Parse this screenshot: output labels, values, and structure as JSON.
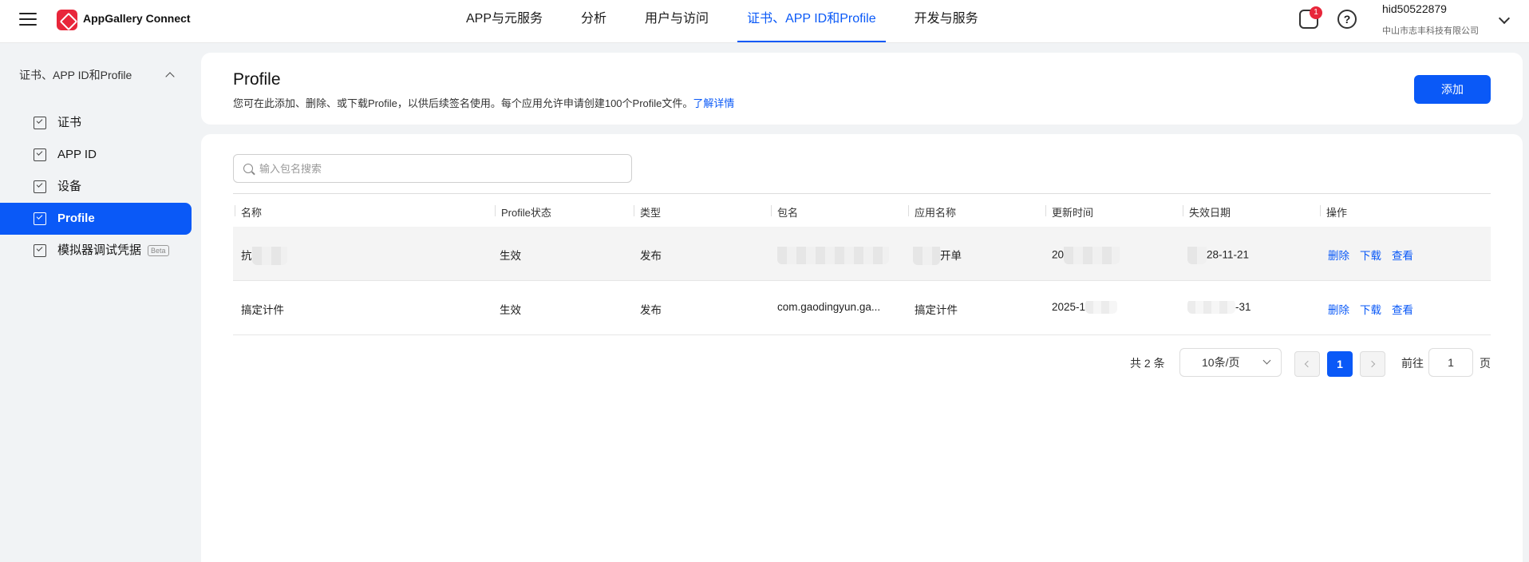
{
  "app": {
    "brand": "AppGallery Connect"
  },
  "nav": {
    "items": [
      "APP与元服务",
      "分析",
      "用户与访问",
      "证书、APP ID和Profile",
      "开发与服务"
    ],
    "active_index": 3
  },
  "header": {
    "notifications_count": "1",
    "help_glyph": "?",
    "user_name": "hid50522879",
    "user_org": "中山市志丰科技有限公司"
  },
  "sidebar": {
    "group_label": "证书、APP ID和Profile",
    "items": [
      {
        "label": "证书",
        "icon": "certificate-icon"
      },
      {
        "label": "APP ID",
        "icon": "app-id-icon"
      },
      {
        "label": "设备",
        "icon": "device-icon"
      },
      {
        "label": "Profile",
        "icon": "profile-icon",
        "active": true
      },
      {
        "label": "模拟器调试凭据",
        "icon": "emulator-icon",
        "badge": "Beta"
      }
    ]
  },
  "page": {
    "title": "Profile",
    "description": "您可在此添加、删除、或下载Profile，以供后续签名使用。每个应用允许申请创建100个Profile文件。",
    "learn_more": "了解详情",
    "add_button": "添加"
  },
  "search": {
    "placeholder": "输入包名搜索",
    "value": ""
  },
  "table": {
    "columns": [
      "名称",
      "Profile状态",
      "类型",
      "包名",
      "应用名称",
      "更新时间",
      "失效日期",
      "操作"
    ],
    "rows": [
      {
        "name": "抗",
        "status": "生效",
        "type": "发布",
        "package": "",
        "app_name": "开单",
        "updated": "20",
        "expires": "28-11-21",
        "actions": [
          "删除",
          "下载",
          "查看"
        ]
      },
      {
        "name": "搞定计件",
        "status": "生效",
        "type": "发布",
        "package": "com.gaodingyun.ga...",
        "app_name": "搞定计件",
        "updated": "2025-1",
        "expires": "-31",
        "actions": [
          "删除",
          "下载",
          "查看"
        ]
      }
    ]
  },
  "pagination": {
    "total": "共 2 条",
    "page_size": "10条/页",
    "current_page": "1",
    "goto_label": "前往",
    "goto_value": "1",
    "page_unit": "页"
  },
  "colors": {
    "accent": "#0a59f7",
    "brand": "#e8263a",
    "background": "#f1f3f5"
  }
}
